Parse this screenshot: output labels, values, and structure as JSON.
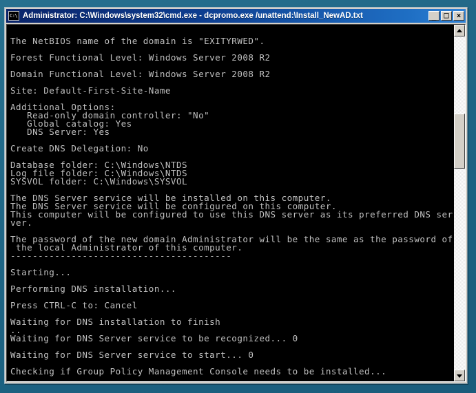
{
  "window": {
    "title": "Administrator: C:\\Windows\\system32\\cmd.exe - dcpromo.exe  /unattend:\\Install_NewAD.txt",
    "icon_label": "C:\\",
    "buttons": {
      "minimize": "_",
      "maximize": "□",
      "close": "×"
    }
  },
  "scrollbar": {
    "up_arrow": "▲",
    "down_arrow": "▼"
  },
  "console": {
    "lines": [
      "",
      "The NetBIOS name of the domain is \"EXITYRWED\".",
      "",
      "Forest Functional Level: Windows Server 2008 R2",
      "",
      "Domain Functional Level: Windows Server 2008 R2",
      "",
      "Site: Default-First-Site-Name",
      "",
      "Additional Options:",
      "   Read-only domain controller: \"No\"",
      "   Global catalog: Yes",
      "   DNS Server: Yes",
      "",
      "Create DNS Delegation: No",
      "",
      "Database folder: C:\\Windows\\NTDS",
      "Log file folder: C:\\Windows\\NTDS",
      "SYSVOL folder: C:\\Windows\\SYSVOL",
      "",
      "The DNS Server service will be installed on this computer.",
      "The DNS Server service will be configured on this computer.",
      "This computer will be configured to use this DNS server as its preferred DNS ser",
      "ver.",
      "",
      "The password of the new domain Administrator will be the same as the password of",
      " the local Administrator of this computer.",
      "----------------------------------------",
      "",
      "Starting...",
      "",
      "Performing DNS installation...",
      "",
      "Press CTRL-C to: Cancel",
      "",
      "Waiting for DNS installation to finish",
      "..",
      "Waiting for DNS Server service to be recognized... 0",
      "",
      "Waiting for DNS Server service to start... 0",
      "",
      "Checking if Group Policy Management Console needs to be installed..."
    ]
  },
  "colors": {
    "desktop": "#1f6988",
    "console_background": "#000000",
    "console_text": "#c0c0c0",
    "titlebar_start": "#0a246a",
    "titlebar_end": "#2f82d6",
    "chrome": "#d4d0c8"
  }
}
